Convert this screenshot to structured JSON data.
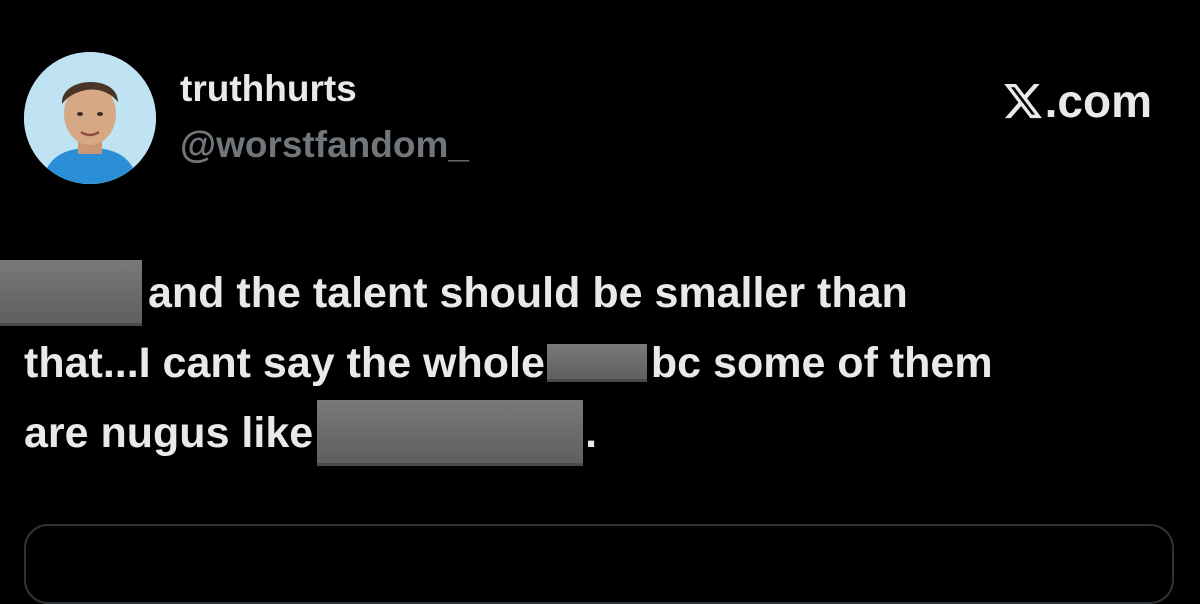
{
  "author": {
    "display_name": "truthhurts",
    "handle": "@worstfandom_",
    "avatar_icon": "profile-photo"
  },
  "brand": {
    "icon": "x-logo-icon",
    "domain": ".com"
  },
  "post": {
    "line1_text": "and the talent should be smaller than",
    "line2_before": "that...I cant say the whole",
    "line2_after": "bc some of them",
    "line3_before": "are nugus like",
    "line3_after": "."
  },
  "colors": {
    "background": "#000000",
    "primary_text": "#e7e9ea",
    "secondary_text": "#71767b",
    "redaction": "#6b6b6b",
    "card_border": "#2f3336"
  }
}
